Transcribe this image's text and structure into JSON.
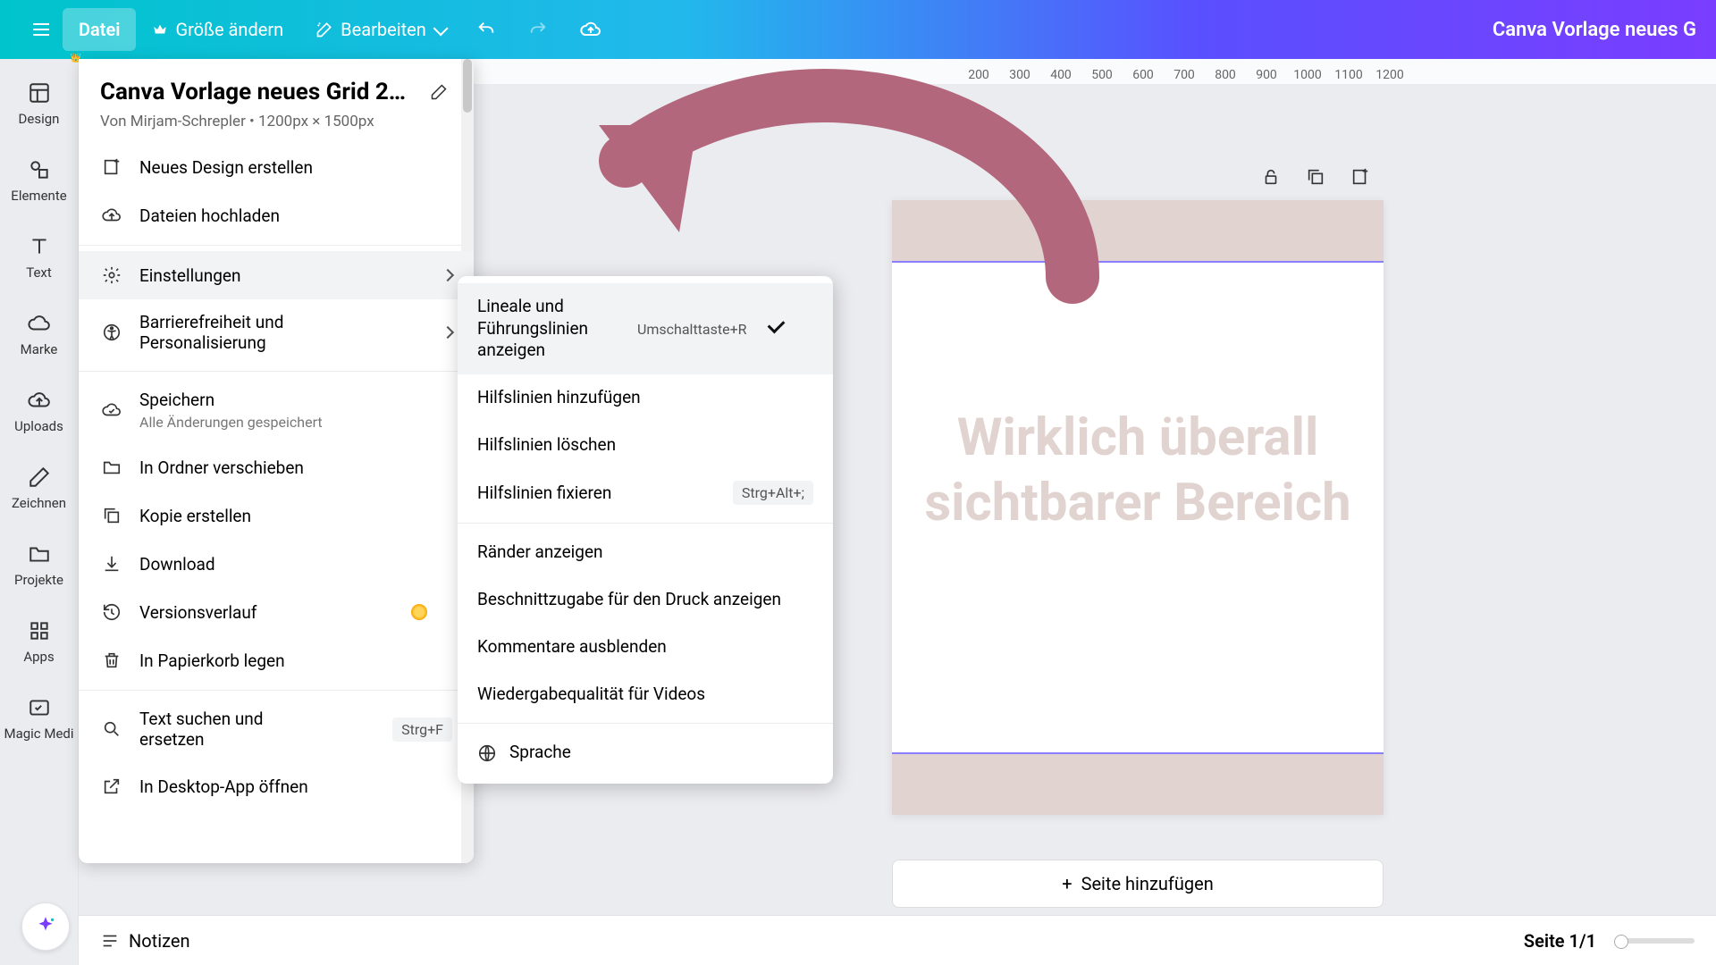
{
  "topbar": {
    "file": "Datei",
    "resize": "Größe ändern",
    "edit": "Bearbeiten",
    "doc_title": "Canva Vorlage neues G"
  },
  "siderail": {
    "items": [
      {
        "icon": "design",
        "label": "Design"
      },
      {
        "icon": "elements",
        "label": "Elemente"
      },
      {
        "icon": "text",
        "label": "Text"
      },
      {
        "icon": "brand",
        "label": "Marke"
      },
      {
        "icon": "uploads",
        "label": "Uploads"
      },
      {
        "icon": "draw",
        "label": "Zeichnen"
      },
      {
        "icon": "projects",
        "label": "Projekte"
      },
      {
        "icon": "apps",
        "label": "Apps"
      },
      {
        "icon": "magic",
        "label": "Magic Medi"
      }
    ]
  },
  "ruler": [
    "200",
    "300",
    "400",
    "500",
    "600",
    "700",
    "800",
    "900",
    "1000",
    "1100",
    "1200"
  ],
  "file_menu": {
    "title": "Canva Vorlage neues Grid 2…",
    "subtitle": "Von Mirjam-Schrepler • 1200px × 1500px",
    "items": [
      {
        "icon": "new",
        "label": "Neues Design erstellen"
      },
      {
        "icon": "upload",
        "label": "Dateien hochladen"
      }
    ],
    "settings_label": "Einstellungen",
    "a11y_label": "Barrierefreiheit und Personalisierung",
    "save_label": "Speichern",
    "save_sub": "Alle Änderungen gespeichert",
    "move_label": "In Ordner verschieben",
    "copy_label": "Kopie erstellen",
    "download_label": "Download",
    "history_label": "Versionsverlauf",
    "trash_label": "In Papierkorb legen",
    "find_label": "Text suchen und ersetzen",
    "find_kbd": "Strg+F",
    "desktop_label": "In Desktop-App öffnen"
  },
  "settings_submenu": {
    "rulers_label": "Lineale und Führungslinien anzeigen",
    "rulers_kbd": "Umschalttaste+R",
    "add_guides": "Hilfslinien hinzufügen",
    "delete_guides": "Hilfslinien löschen",
    "lock_guides": "Hilfslinien fixieren",
    "lock_kbd": "Strg+Alt+;",
    "margins": "Ränder anzeigen",
    "bleed": "Beschnittzugabe für den Druck anzeigen",
    "hide_comments": "Kommentare ausblenden",
    "video_quality": "Wiedergabequalität für Videos",
    "language": "Sprache"
  },
  "canvas": {
    "text_line1": "Wirklich überall",
    "text_line2": "sichtbarer Bereich",
    "add_page": "Seite hinzufügen"
  },
  "bottom": {
    "notes": "Notizen",
    "page_count": "Seite 1/1"
  }
}
